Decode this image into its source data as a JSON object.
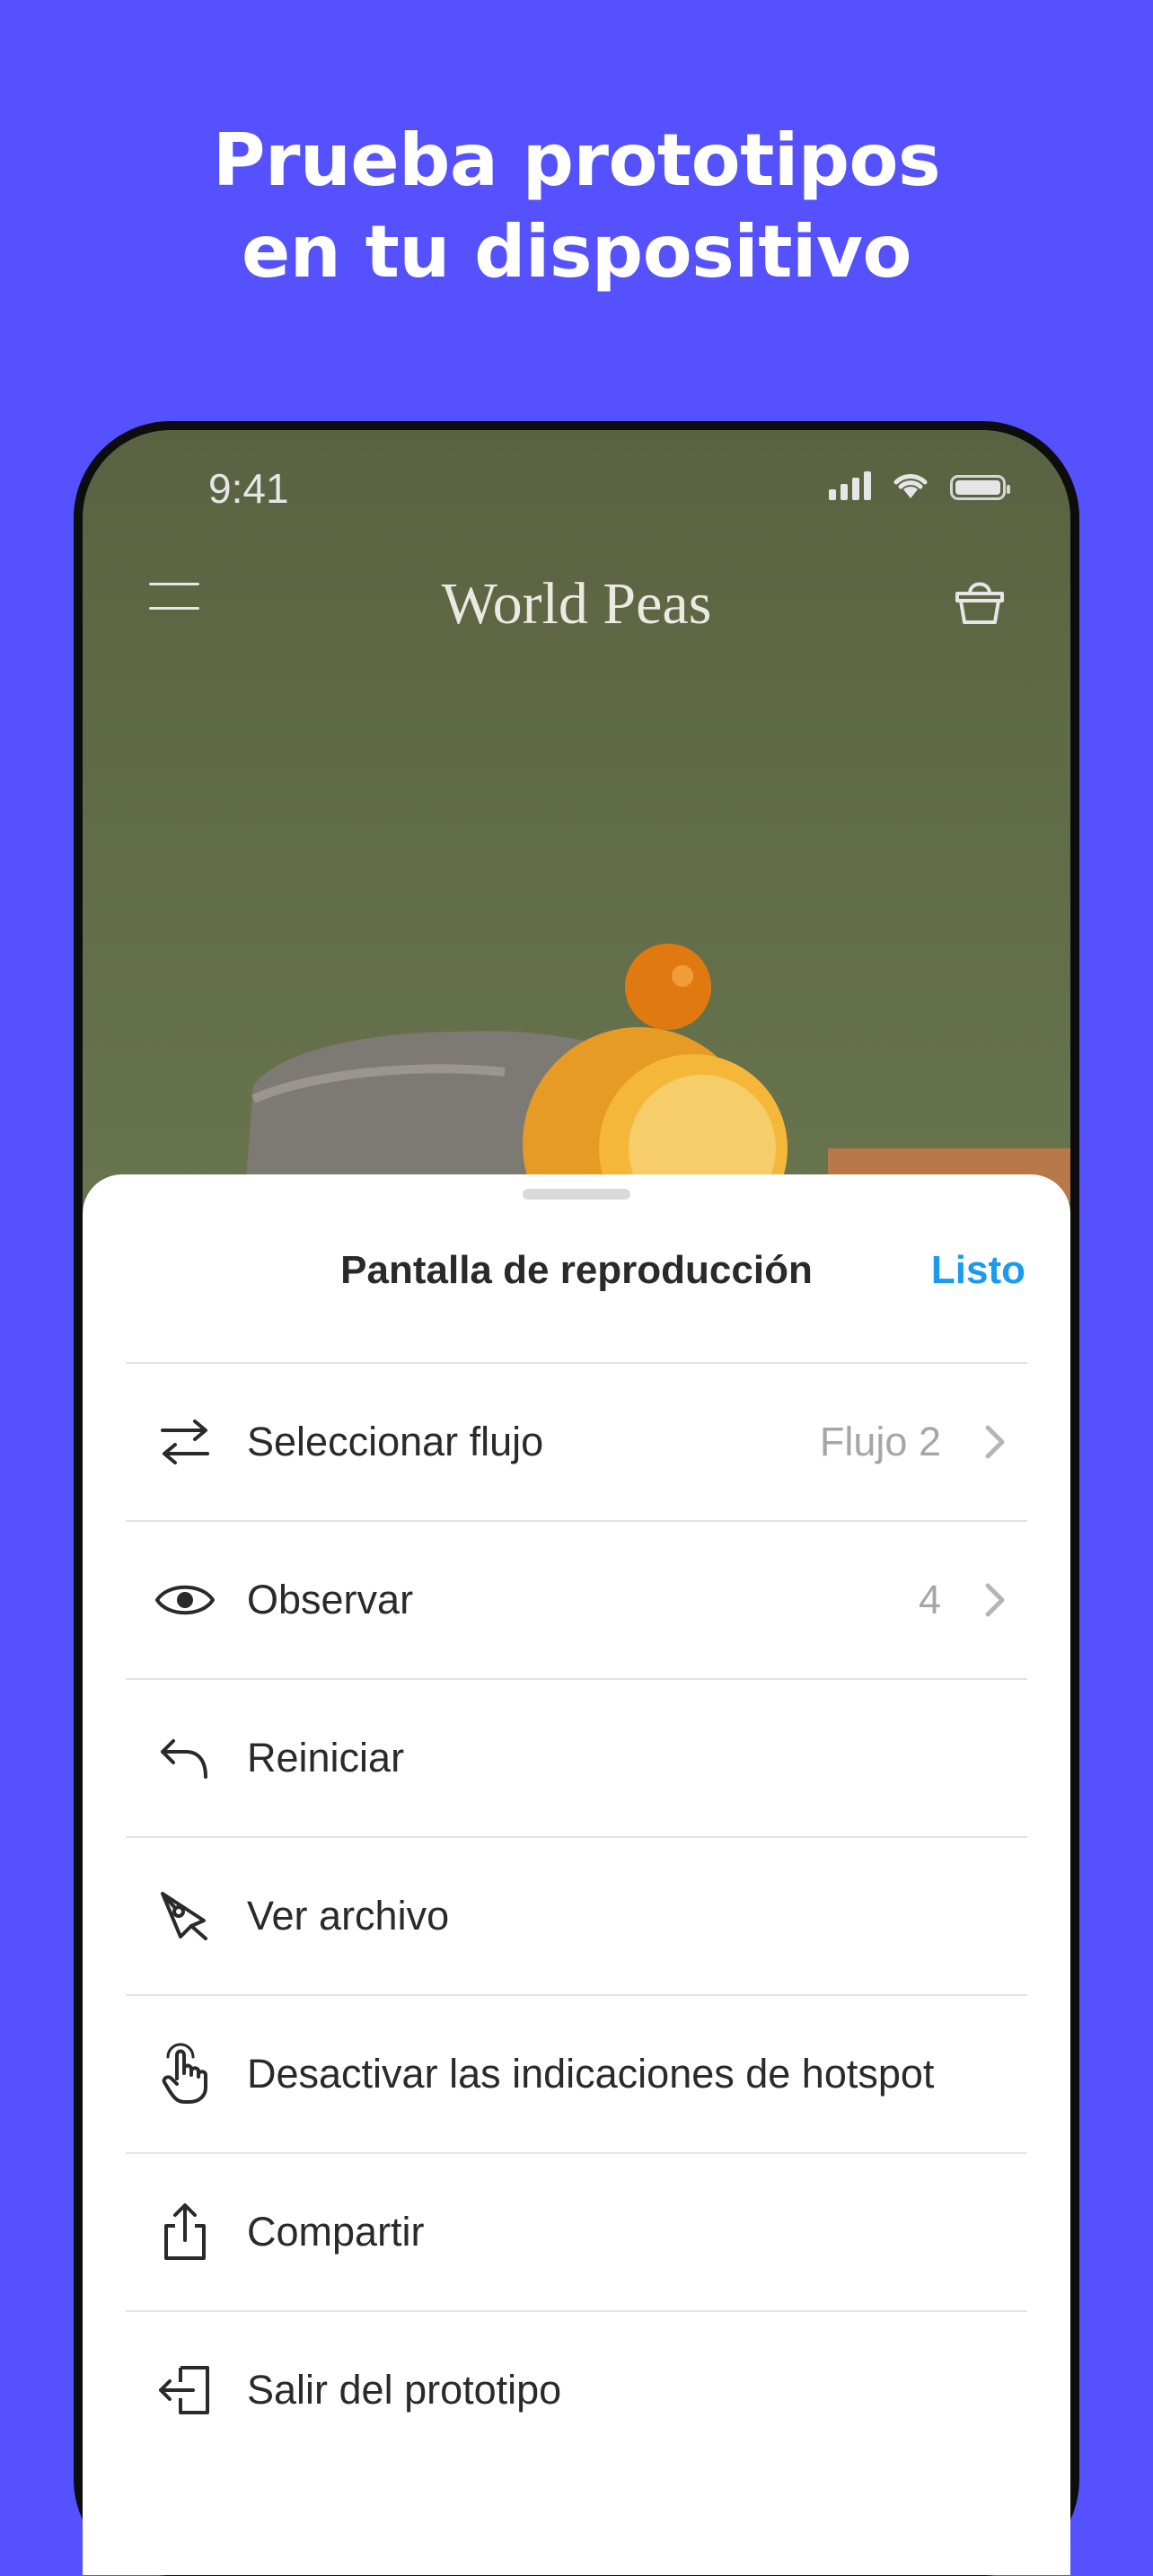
{
  "headline": {
    "line1": "Prueba prototipos",
    "line2": "en tu dispositivo"
  },
  "status_bar": {
    "time": "9:41"
  },
  "app_bar": {
    "brand": "World Peas"
  },
  "sheet": {
    "title": "Pantalla de reproducción",
    "done_label": "Listo",
    "items": [
      {
        "label": "Seleccionar flujo",
        "value": "Flujo 2",
        "icon": "arrows-flow-icon"
      },
      {
        "label": "Observar",
        "value": "4",
        "icon": "eye-icon"
      },
      {
        "label": "Reiniciar",
        "value": "",
        "icon": "undo-icon"
      },
      {
        "label": "Ver archivo",
        "value": "",
        "icon": "pen-tool-icon"
      },
      {
        "label": "Desactivar las indicaciones de hotspot",
        "value": "",
        "icon": "hand-pointer-icon"
      },
      {
        "label": "Compartir",
        "value": "",
        "icon": "share-icon"
      },
      {
        "label": "Salir del prototipo",
        "value": "",
        "icon": "exit-icon"
      }
    ]
  },
  "colors": {
    "background": "#5551FF",
    "accent": "#1A9BF0",
    "text": "#2a2a2a",
    "muted": "#a6a6a6"
  }
}
